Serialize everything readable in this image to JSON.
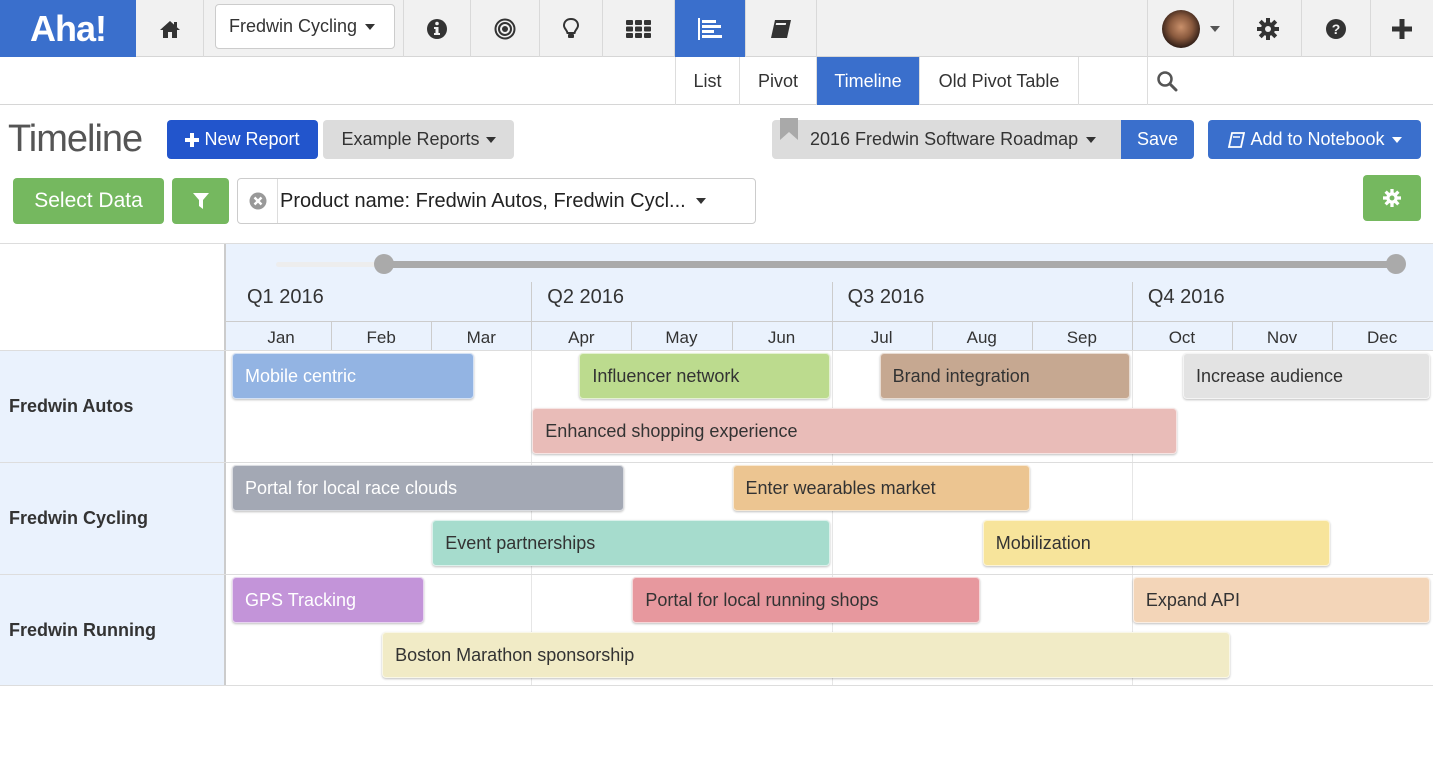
{
  "app": {
    "logo": "Aha!",
    "product_selector": "Fredwin Cycling",
    "brand_color": "#3a6fcc"
  },
  "topnav": {
    "icons": [
      "home-icon",
      "info-icon",
      "goals-icon",
      "ideas-icon",
      "apps-grid-icon",
      "roadmaps-icon",
      "notebook-icon"
    ],
    "active_icon": "roadmaps-icon",
    "right_icons": [
      "avatar",
      "settings-icon",
      "help-icon",
      "add-icon"
    ]
  },
  "subnav": {
    "tabs": [
      {
        "label": "List",
        "active": false
      },
      {
        "label": "Pivot",
        "active": false
      },
      {
        "label": "Timeline",
        "active": true
      },
      {
        "label": "Old Pivot Table",
        "active": false
      }
    ],
    "search_placeholder": ""
  },
  "toolbar": {
    "title": "Timeline",
    "new_report": "New Report",
    "example_reports": "Example Reports",
    "saved_report": "2016 Fredwin Software Roadmap",
    "save": "Save",
    "add_to_notebook": "Add to Notebook",
    "select_data": "Select Data",
    "filter_text": "Product name: Fredwin Autos, Fredwin Cycl..."
  },
  "timeline": {
    "quarters": [
      "Q1 2016",
      "Q2 2016",
      "Q3 2016",
      "Q4 2016"
    ],
    "months": [
      "Jan",
      "Feb",
      "Mar",
      "Apr",
      "May",
      "Jun",
      "Jul",
      "Aug",
      "Sep",
      "Oct",
      "Nov",
      "Dec"
    ],
    "range_slider": {
      "start_fraction": 0.0,
      "end_fraction": 1.0
    },
    "rows": [
      {
        "label": "Fredwin Autos",
        "bars": [
          {
            "label": "Mobile centric",
            "start_month": 0.0,
            "end_month": 2.45,
            "lane": 0,
            "color": "#93b4e3",
            "light_text": true
          },
          {
            "label": "Influencer network",
            "start_month": 3.47,
            "end_month": 6.0,
            "lane": 0,
            "color": "#bcdb8e",
            "light_text": false
          },
          {
            "label": "Brand integration",
            "start_month": 6.47,
            "end_month": 9.0,
            "lane": 0,
            "color": "#c6a891",
            "light_text": false
          },
          {
            "label": "Increase audience",
            "start_month": 9.5,
            "end_month": 12.0,
            "lane": 0,
            "color": "#e3e3e3",
            "light_text": false
          },
          {
            "label": "Enhanced shopping experience",
            "start_month": 3.0,
            "end_month": 9.47,
            "lane": 1,
            "color": "#e9bcb8",
            "light_text": false
          }
        ]
      },
      {
        "label": "Fredwin Cycling",
        "bars": [
          {
            "label": "Portal for local race clouds",
            "start_month": 0.0,
            "end_month": 3.95,
            "lane": 0,
            "color": "#a3a8b4",
            "light_text": true
          },
          {
            "label": "Enter wearables market",
            "start_month": 5.0,
            "end_month": 8.0,
            "lane": 0,
            "color": "#ecc591",
            "light_text": false
          },
          {
            "label": "Event partnerships",
            "start_month": 2.0,
            "end_month": 6.0,
            "lane": 1,
            "color": "#a6dccd",
            "light_text": false
          },
          {
            "label": "Mobilization",
            "start_month": 7.5,
            "end_month": 11.0,
            "lane": 1,
            "color": "#f7e49b",
            "light_text": false
          }
        ]
      },
      {
        "label": "Fredwin Running",
        "bars": [
          {
            "label": "GPS Tracking",
            "start_month": 0.0,
            "end_month": 1.95,
            "lane": 0,
            "color": "#c394d9",
            "light_text": true
          },
          {
            "label": "Portal for local running shops",
            "start_month": 4.0,
            "end_month": 7.5,
            "lane": 0,
            "color": "#e7989e",
            "light_text": false
          },
          {
            "label": "Expand API",
            "start_month": 9.0,
            "end_month": 12.0,
            "lane": 0,
            "color": "#f3d5b8",
            "light_text": false
          },
          {
            "label": "Boston Marathon sponsorship",
            "start_month": 1.5,
            "end_month": 10.0,
            "lane": 1,
            "color": "#f1ebc6",
            "light_text": false
          }
        ]
      }
    ]
  }
}
